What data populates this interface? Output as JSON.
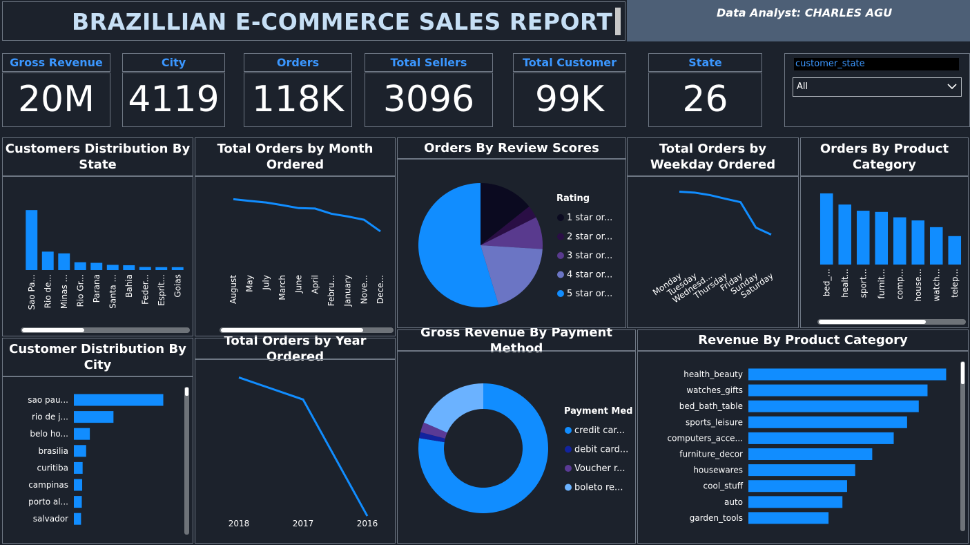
{
  "header": {
    "title": "BRAZILLIAN E-COMMERCE SALES REPORT",
    "analyst": "Data Analyst: CHARLES AGU"
  },
  "kpis": [
    {
      "label": "Gross Revenue",
      "value": "20M"
    },
    {
      "label": "City",
      "value": "4119"
    },
    {
      "label": "Orders",
      "value": "118K"
    },
    {
      "label": "Total Sellers",
      "value": "3096"
    },
    {
      "label": "Total Customer",
      "value": "99K"
    },
    {
      "label": "State",
      "value": "26"
    }
  ],
  "slicer": {
    "field": "customer_state",
    "selected": "All"
  },
  "panels": {
    "customers_state": "Customers Distribution By State",
    "orders_month": "Total Orders by Month Ordered",
    "review_scores": "Orders By Review Scores",
    "orders_weekday": "Total Orders by Weekday Ordered",
    "product_category": "Orders By Product Category",
    "customer_city": "Customer Distribution By City",
    "orders_year": "Total Orders by Year Ordered",
    "payment_method": "Gross Revenue By Payment Method",
    "revenue_category": "Revenue By Product Category"
  },
  "colors": {
    "accent": "#3b97ff",
    "bar": "#118dff",
    "background": "#1c222c",
    "border": "#6e7784"
  },
  "chart_data": [
    {
      "id": "state",
      "type": "bar",
      "categories": [
        "Sao Pa...",
        "Rio de...",
        "Minas ...",
        "Rio Gr...",
        "Parana",
        "Santa ...",
        "Bahia",
        "Feder...",
        "Esprit...",
        "Goias"
      ],
      "values": [
        41746,
        12852,
        11635,
        5466,
        5045,
        3637,
        3380,
        2140,
        2033,
        2020
      ],
      "ylim": [
        0,
        50000
      ]
    },
    {
      "id": "month",
      "type": "line",
      "categories": [
        "August",
        "May",
        "July",
        "March",
        "June",
        "April",
        "Febru...",
        "January",
        "Nove...",
        "Dece..."
      ],
      "values": [
        10843,
        10573,
        10318,
        9893,
        9412,
        9343,
        8508,
        8069,
        7544,
        5674
      ],
      "ylim": [
        0,
        12000
      ]
    },
    {
      "id": "review",
      "type": "pie",
      "legend_title": "Rating",
      "labels": [
        "1 star or...",
        "2 star or...",
        "3 star or...",
        "4 star or...",
        "5 star or..."
      ],
      "values": [
        14.3,
        3.3,
        8.4,
        19.3,
        54.7
      ],
      "colors": [
        "#0b0a20",
        "#2a0e45",
        "#593a8e",
        "#6b75c4",
        "#118dff"
      ]
    },
    {
      "id": "weekday",
      "type": "line",
      "categories": [
        "Monday",
        "Tuesday",
        "Wednesd...",
        "Thursday",
        "Friday",
        "Sunday",
        "Saturday"
      ],
      "values": [
        19130,
        18951,
        18451,
        17723,
        17034,
        11960,
        10555
      ],
      "ylim": [
        0,
        21000
      ]
    },
    {
      "id": "category",
      "type": "bar",
      "categories": [
        "bed_...",
        "healt...",
        "sport...",
        "furnit...",
        "comp...",
        "house...",
        "watch...",
        "telep..."
      ],
      "values": [
        11823,
        9972,
        8945,
        8744,
        7849,
        7331,
        6213,
        4726
      ],
      "ylim": [
        0,
        14000
      ]
    },
    {
      "id": "city",
      "type": "bar",
      "orientation": "horizontal",
      "categories": [
        "sao pau...",
        "rio de j...",
        "belo ho...",
        "brasilia",
        "curitiba",
        "campinas",
        "porto al...",
        "salvador"
      ],
      "values": [
        15540,
        6882,
        2773,
        2131,
        1521,
        1444,
        1379,
        1245
      ],
      "xlim": [
        0,
        21000
      ]
    },
    {
      "id": "year",
      "type": "line",
      "categories": [
        "2018",
        "2017",
        "2016"
      ],
      "values": [
        63000,
        53000,
        300
      ],
      "ylim": [
        0,
        70000
      ]
    },
    {
      "id": "payment",
      "type": "pie",
      "legend_title": "Payment Med",
      "labels": [
        "credit car...",
        "debit card...",
        "Voucher r...",
        "boleto re..."
      ],
      "values": [
        77.5,
        1.5,
        2.5,
        18.5
      ],
      "colors": [
        "#118dff",
        "#12239e",
        "#5a3a95",
        "#6bb2ff"
      ]
    },
    {
      "id": "revenue",
      "type": "bar",
      "orientation": "horizontal",
      "categories": [
        "health_beauty",
        "watches_gifts",
        "bed_bath_table",
        "sports_leisure",
        "computers_acce...",
        "furniture_decor",
        "housewares",
        "cool_stuff",
        "auto",
        "garden_tools"
      ],
      "values": [
        1441248,
        1305542,
        1241682,
        1156656,
        1059272,
        902511,
        778398,
        719329,
        685385,
        584219
      ],
      "xlim": [
        0,
        1600000
      ]
    }
  ]
}
